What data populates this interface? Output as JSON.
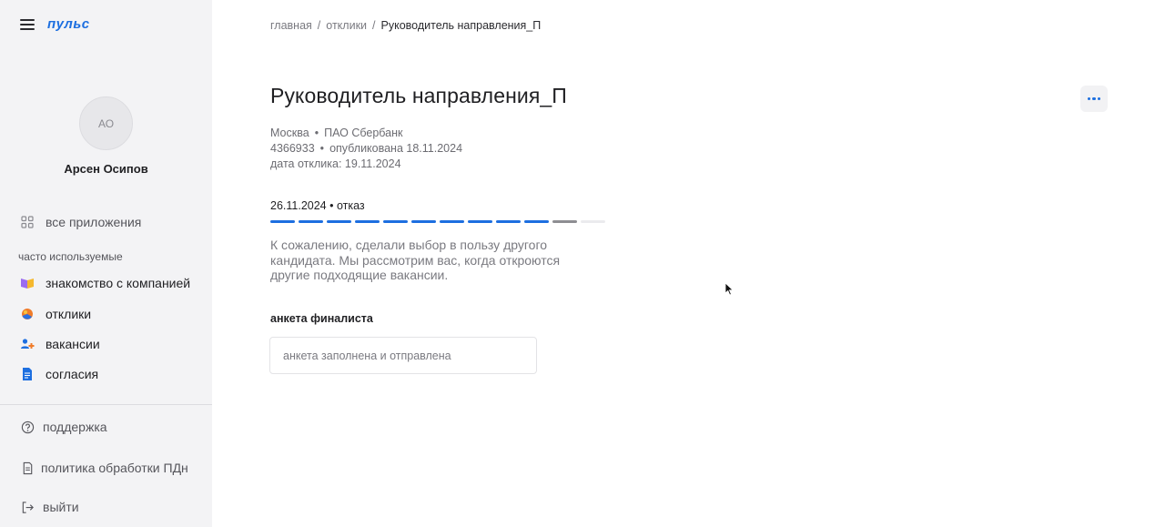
{
  "app": {
    "logo": "пульс"
  },
  "sidebar": {
    "avatar_initials": "АО",
    "username": "Арсен Осипов",
    "all_apps": "все приложения",
    "section_label": "часто используемые",
    "items": [
      {
        "label": "знакомство с компанией",
        "icon": "book-icon",
        "color": "#f0a830"
      },
      {
        "label": "отклики",
        "icon": "responses-icon",
        "color": "#e85d2a"
      },
      {
        "label": "вакансии",
        "icon": "add-user-icon",
        "color": "#1d6fe0"
      },
      {
        "label": "согласия",
        "icon": "document-icon",
        "color": "#1d6fe0"
      }
    ],
    "bottom": [
      {
        "label": "поддержка",
        "icon": "help-circle-icon"
      },
      {
        "label": "политика обработки ПДн",
        "icon": "file-icon"
      },
      {
        "label": "выйти",
        "icon": "logout-icon"
      }
    ]
  },
  "breadcrumb": {
    "home": "главная",
    "responses": "отклики",
    "current": "Руководитель направления_П"
  },
  "vacancy": {
    "title": "Руководитель направления_П",
    "city": "Москва",
    "company": "ПАО Сбербанк",
    "id": "4366933",
    "published": "опубликована 18.11.2024",
    "response_date": "дата отклика: 19.11.2024"
  },
  "status": {
    "text": "26.11.2024 • отказ",
    "segments_total": 12,
    "segments_done": 10,
    "segments_grey": 1,
    "message": "К сожалению, сделали выбор в пользу другого кандидата. Мы рассмотрим вас, когда откроются другие подходящие вакансии."
  },
  "finalist": {
    "title": "анкета финалиста",
    "status": "анкета заполнена и отправлена"
  },
  "colors": {
    "accent": "#1d6fe0",
    "sidebar_bg": "#f3f3f5"
  }
}
